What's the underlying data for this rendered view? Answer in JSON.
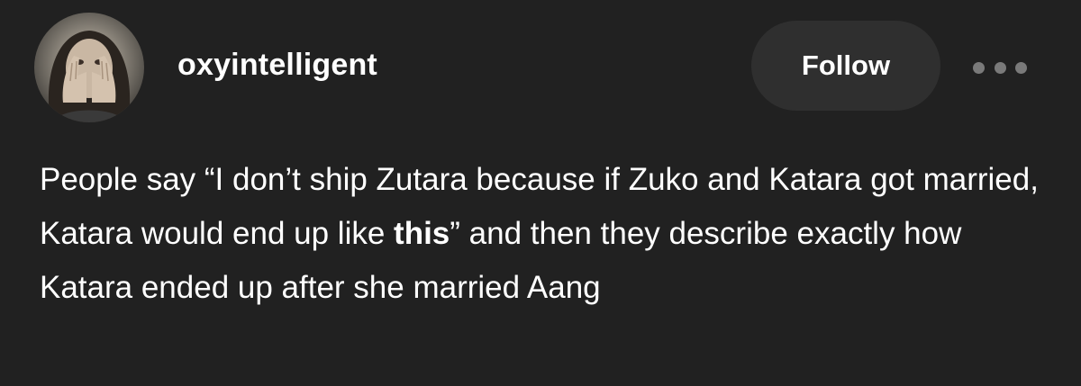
{
  "post": {
    "username": "oxyintelligent",
    "follow_label": "Follow",
    "more_icon": "ellipsis-icon",
    "avatar_icon": "avatar",
    "body": {
      "text_before_bold": "People say “I don’t ship Zutara because if Zuko and Katara got married, Katara would end up like ",
      "bold_text": "this",
      "text_after_bold": "” and then they describe exactly how Katara ended up after she married Aang"
    }
  },
  "colors": {
    "background": "#212121",
    "button_background": "#2f2f2f",
    "text": "#ffffff",
    "muted_icon": "#7a7a7a"
  }
}
